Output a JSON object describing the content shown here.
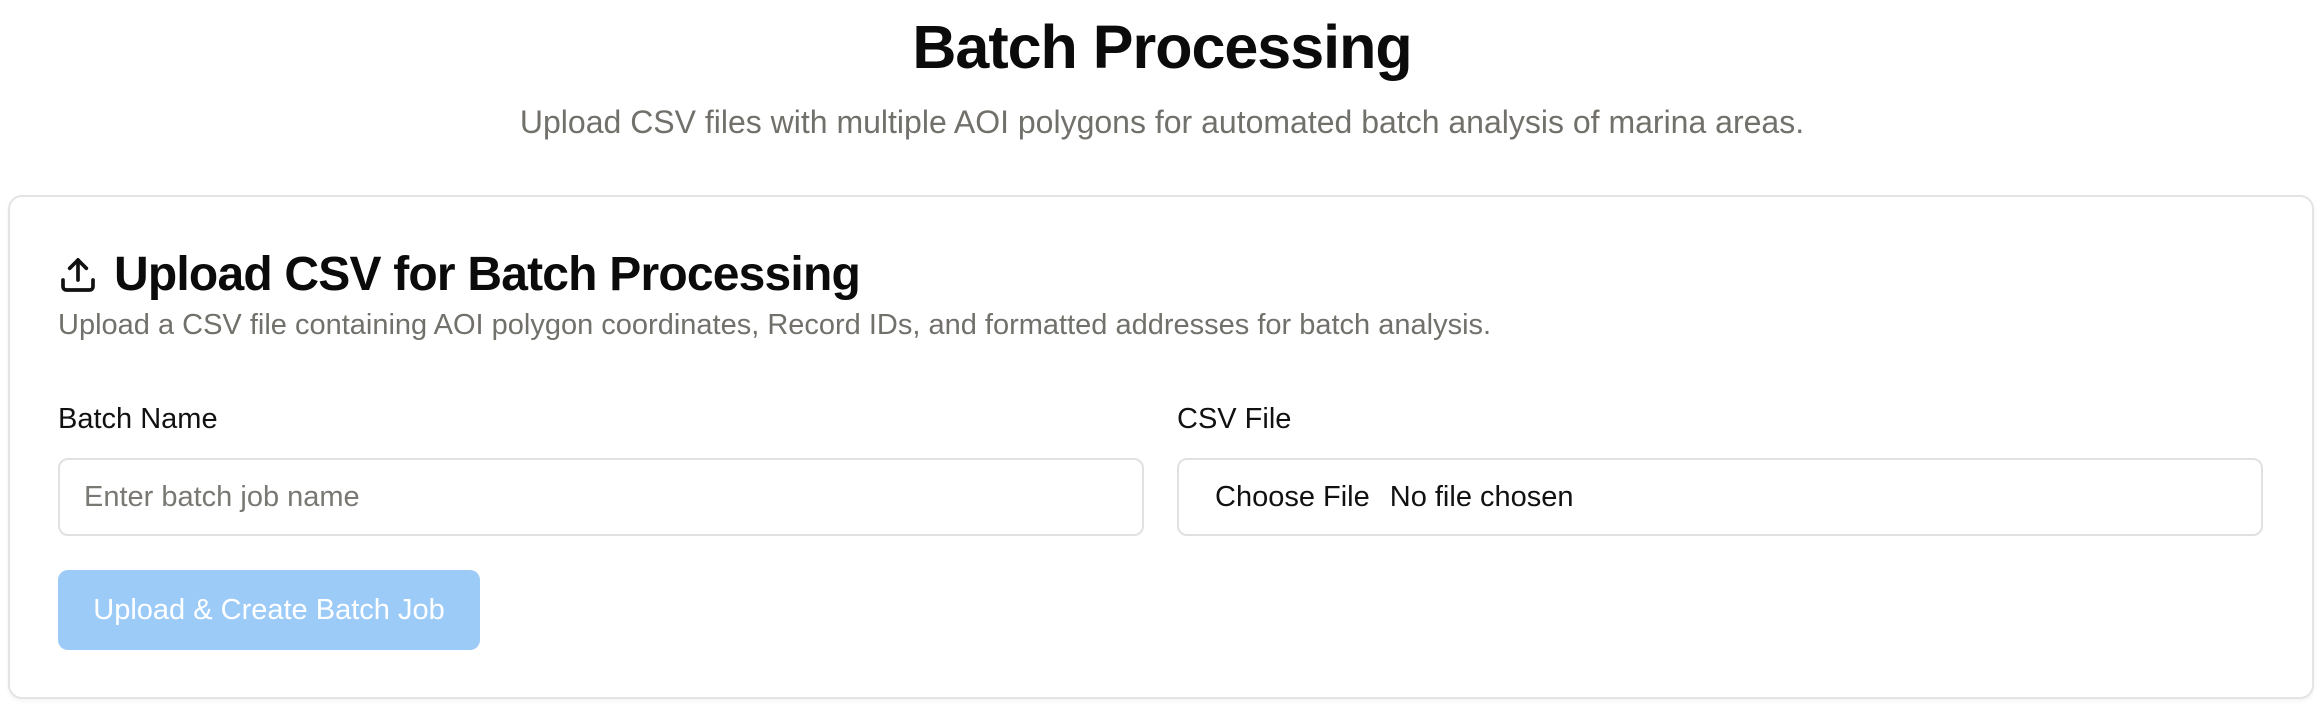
{
  "header": {
    "title": "Batch Processing",
    "subtitle": "Upload CSV files with multiple AOI polygons for automated batch analysis of marina areas."
  },
  "upload_card": {
    "icon": "upload-icon",
    "title": "Upload CSV for Batch Processing",
    "description": "Upload a CSV file containing AOI polygon coordinates, Record IDs, and formatted addresses for batch analysis.",
    "batch_name": {
      "label": "Batch Name",
      "value": "",
      "placeholder": "Enter batch job name"
    },
    "csv_file": {
      "label": "CSV File",
      "choose_label": "Choose File",
      "status": "No file chosen"
    },
    "submit_label": "Upload & Create Batch Job",
    "submit_disabled": true
  },
  "colors": {
    "title_text": "#0b0b0b",
    "muted_text": "#72706b",
    "border": "#e4e4e4",
    "button_disabled_bg": "#9ccbf8",
    "button_text": "#ffffff"
  }
}
